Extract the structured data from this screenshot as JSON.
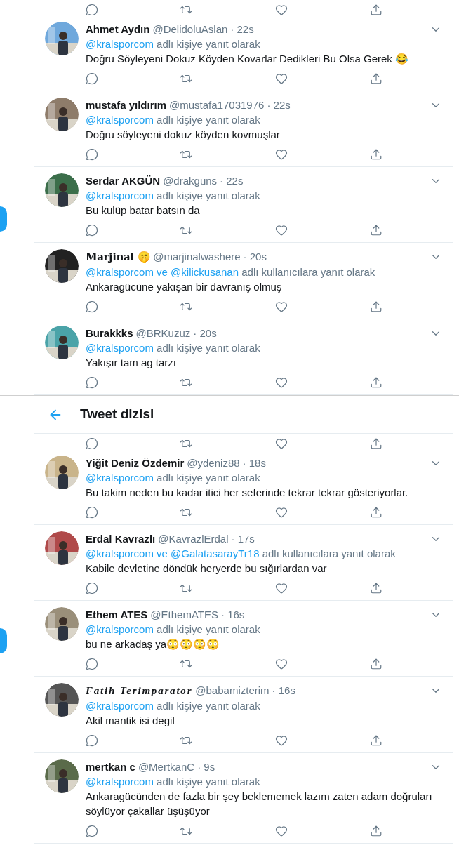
{
  "sections": [
    {
      "clipped_actions_row": true,
      "tweets": [
        {
          "name": "Ahmet Aydın",
          "kind": "plain",
          "handle": "@DelidoluAslan",
          "time": "· 22s",
          "reply": {
            "mentions": [
              "@kralsporcom"
            ],
            "suffix": "adlı kişiye yanıt olarak"
          },
          "lines": [
            "Doğru Söyleyeni Dokuz Köyden Kovarlar Dedikleri Bu Olsa Gerek 😂"
          ]
        },
        {
          "name": "mustafa yıldırım",
          "kind": "plain",
          "handle": "@mustafa17031976",
          "time": "· 22s",
          "reply": {
            "mentions": [
              "@kralsporcom"
            ],
            "suffix": "adlı kişiye yanıt olarak"
          },
          "lines": [
            "Doğru söyleyeni dokuz köyden kovmuşlar"
          ]
        },
        {
          "name": "Serdar AKGÜN",
          "kind": "plain",
          "handle": "@drakguns",
          "time": "· 22s",
          "reply": {
            "mentions": [
              "@kralsporcom"
            ],
            "suffix": "adlı kişiye yanıt olarak"
          },
          "lines": [
            "Bu kulüp batar batsın da"
          ]
        },
        {
          "name": "Marjinal 🤫",
          "kind": "blackletter",
          "handle": "@marjinalwashere",
          "time": "· 20s",
          "reply": {
            "mentions": [
              "@kralsporcom",
              "@kilickusanan"
            ],
            "joiner": "ve",
            "suffix": "adlı kullanıcılara yanıt olarak"
          },
          "lines": [
            "Ankaragücüne yakışan bir davranış olmuş"
          ]
        },
        {
          "name": "Burakkks",
          "kind": "plain",
          "handle": "@BRKuzuz",
          "time": "· 20s",
          "reply": {
            "mentions": [
              "@kralsporcom"
            ],
            "suffix": "adlı kişiye yanıt olarak"
          },
          "lines": [
            "Yakışır tam ag tarzı"
          ]
        }
      ]
    },
    {
      "clipped_actions_row": true,
      "header": {
        "title": "Tweet dizisi"
      },
      "tweets": [
        {
          "name": "Yiğit Deniz Özdemir",
          "kind": "plain",
          "handle": "@ydeniz88",
          "time": "· 18s",
          "reply": {
            "mentions": [
              "@kralsporcom"
            ],
            "suffix": "adlı kişiye yanıt olarak"
          },
          "lines": [
            "Bu takim neden bu kadar itici her seferinde tekrar tekrar gösteriyorlar."
          ]
        },
        {
          "name": "Erdal Kavrazlı",
          "kind": "plain",
          "handle": "@KavrazlErdal",
          "time": "· 17s",
          "reply": {
            "mentions": [
              "@kralsporcom",
              "@GalatasarayTr18"
            ],
            "joiner": "ve",
            "suffix": "adlı kullanıcılara yanıt olarak"
          },
          "lines": [
            "Kabile devletine döndük heryerde bu sığırlardan var"
          ]
        },
        {
          "name": "Ethem ATES",
          "kind": "plain",
          "handle": "@EthemATES",
          "time": "· 16s",
          "reply": {
            "mentions": [
              "@kralsporcom"
            ],
            "suffix": "adlı kişiye yanıt olarak"
          },
          "lines": [
            "bu ne arkadaş ya😳😳😳😳"
          ]
        },
        {
          "name": "Fatih Terimparator",
          "kind": "script",
          "handle": "@babamizterim",
          "time": "· 16s",
          "reply": {
            "mentions": [
              "@kralsporcom"
            ],
            "suffix": "adlı kişiye yanıt olarak"
          },
          "lines": [
            "Akil mantik isi degil"
          ]
        },
        {
          "name": "mertkan c",
          "kind": "plain",
          "handle": "@MertkanC",
          "time": "· 9s",
          "reply": {
            "mentions": [
              "@kralsporcom"
            ],
            "suffix": "adlı kişiye yanıt olarak"
          },
          "lines": [
            "Ankaragücünden de fazla bir şey beklememek lazım zaten adam doğruları söylüyor çakallar üşüşüyor"
          ]
        }
      ]
    }
  ]
}
